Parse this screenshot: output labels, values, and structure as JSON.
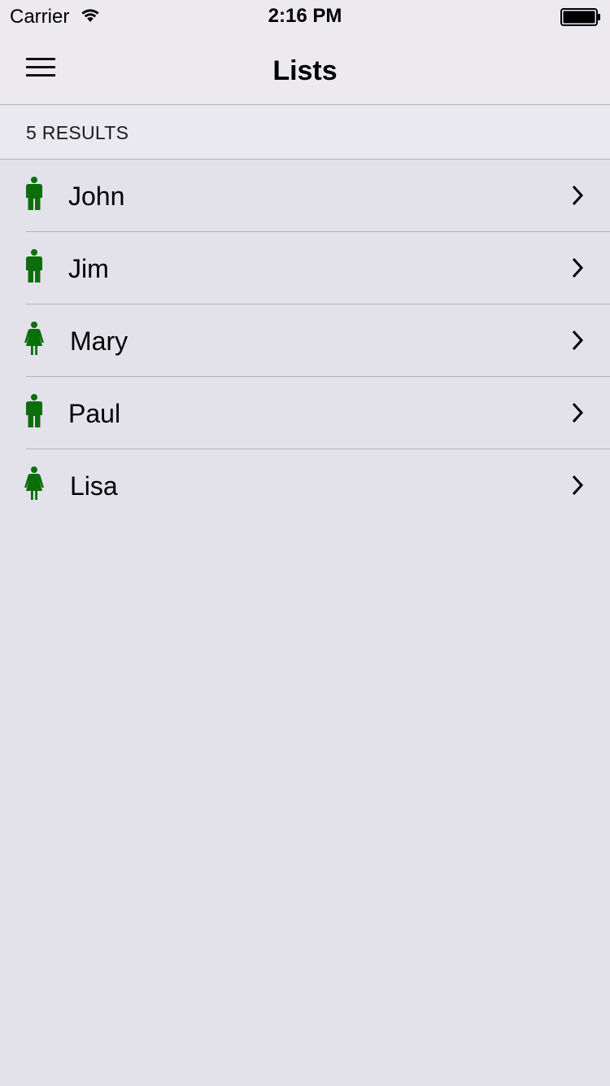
{
  "status_bar": {
    "carrier": "Carrier",
    "time": "2:16 PM",
    "wifi_icon": "wifi-icon",
    "battery_icon": "battery-full-icon"
  },
  "nav_bar": {
    "title": "Lists",
    "menu_icon": "hamburger-menu-icon"
  },
  "section": {
    "results_label": "5 RESULTS"
  },
  "items": [
    {
      "name": "John",
      "icon": "male-person-icon"
    },
    {
      "name": "Jim",
      "icon": "male-person-icon"
    },
    {
      "name": "Mary",
      "icon": "female-person-icon"
    },
    {
      "name": "Paul",
      "icon": "male-person-icon"
    },
    {
      "name": "Lisa",
      "icon": "female-person-icon"
    }
  ],
  "colors": {
    "icon_green": "#0b6e0b",
    "background": "#e3e1e9",
    "bar_background": "#eceaef",
    "divider": "#b5b3b9"
  }
}
